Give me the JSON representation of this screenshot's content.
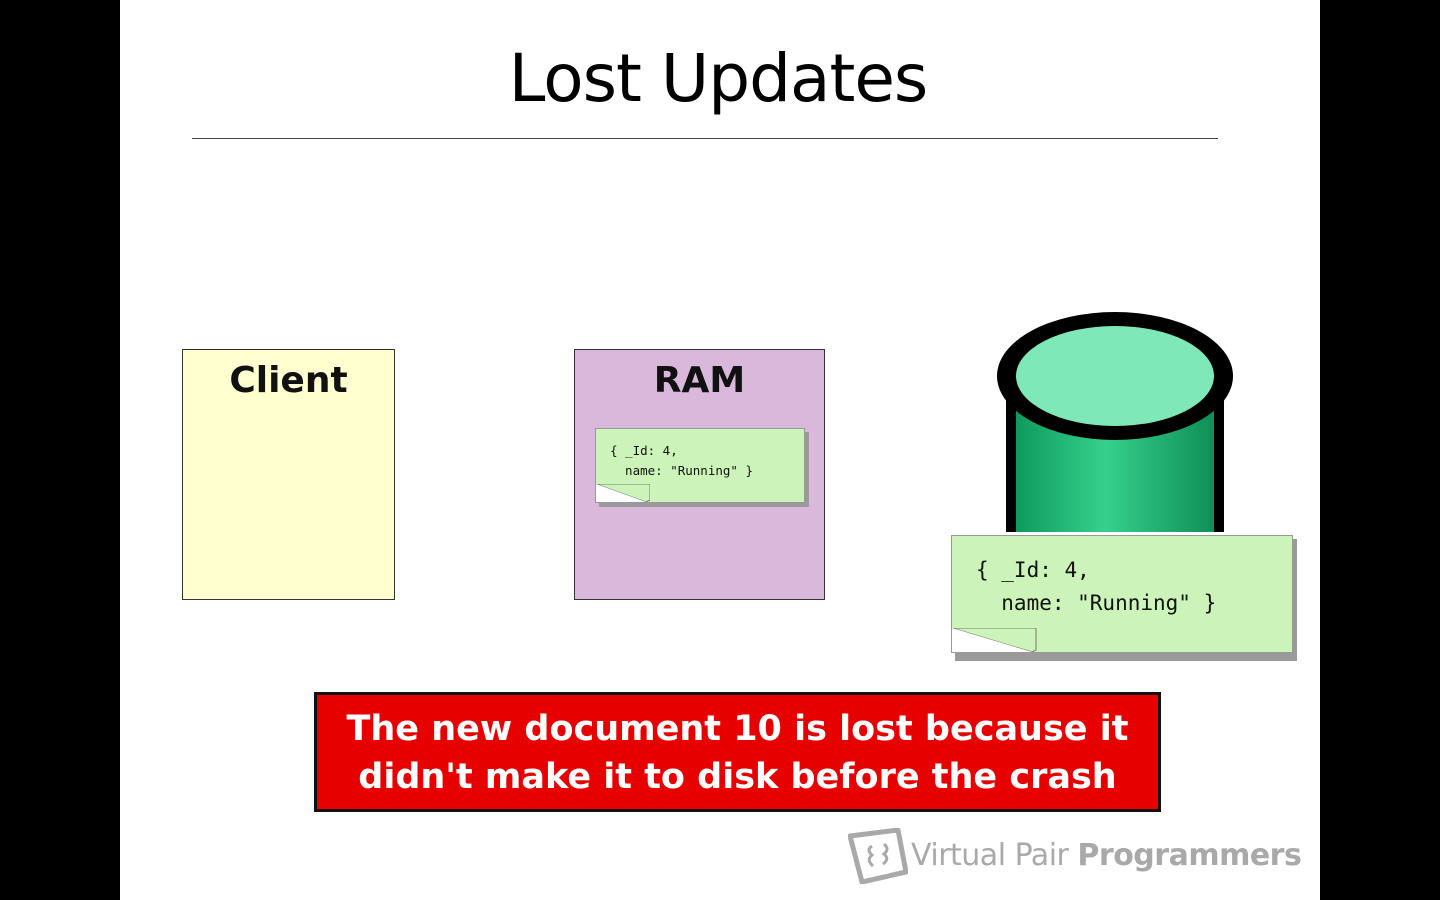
{
  "slide": {
    "title": "Lost Updates"
  },
  "client": {
    "label": "Client"
  },
  "ram": {
    "label": "RAM",
    "document_line1": "{ _Id: 4,",
    "document_line2": "  name: \"Running\" }"
  },
  "disk": {
    "document_line1": "{ _Id: 4,",
    "document_line2": "  name: \"Running\" }"
  },
  "callout": {
    "line1": "The new document 10 is lost because it",
    "line2": "didn't make it to disk before the crash"
  },
  "logo": {
    "word1": "Virtual Pair ",
    "word2": "Programmers"
  },
  "colors": {
    "client_fill": "#ffffd0",
    "ram_fill": "#dab8dc",
    "note_fill": "#ccf4b8",
    "cylinder_fill": "#22c07a",
    "callout_fill": "#e60000"
  }
}
